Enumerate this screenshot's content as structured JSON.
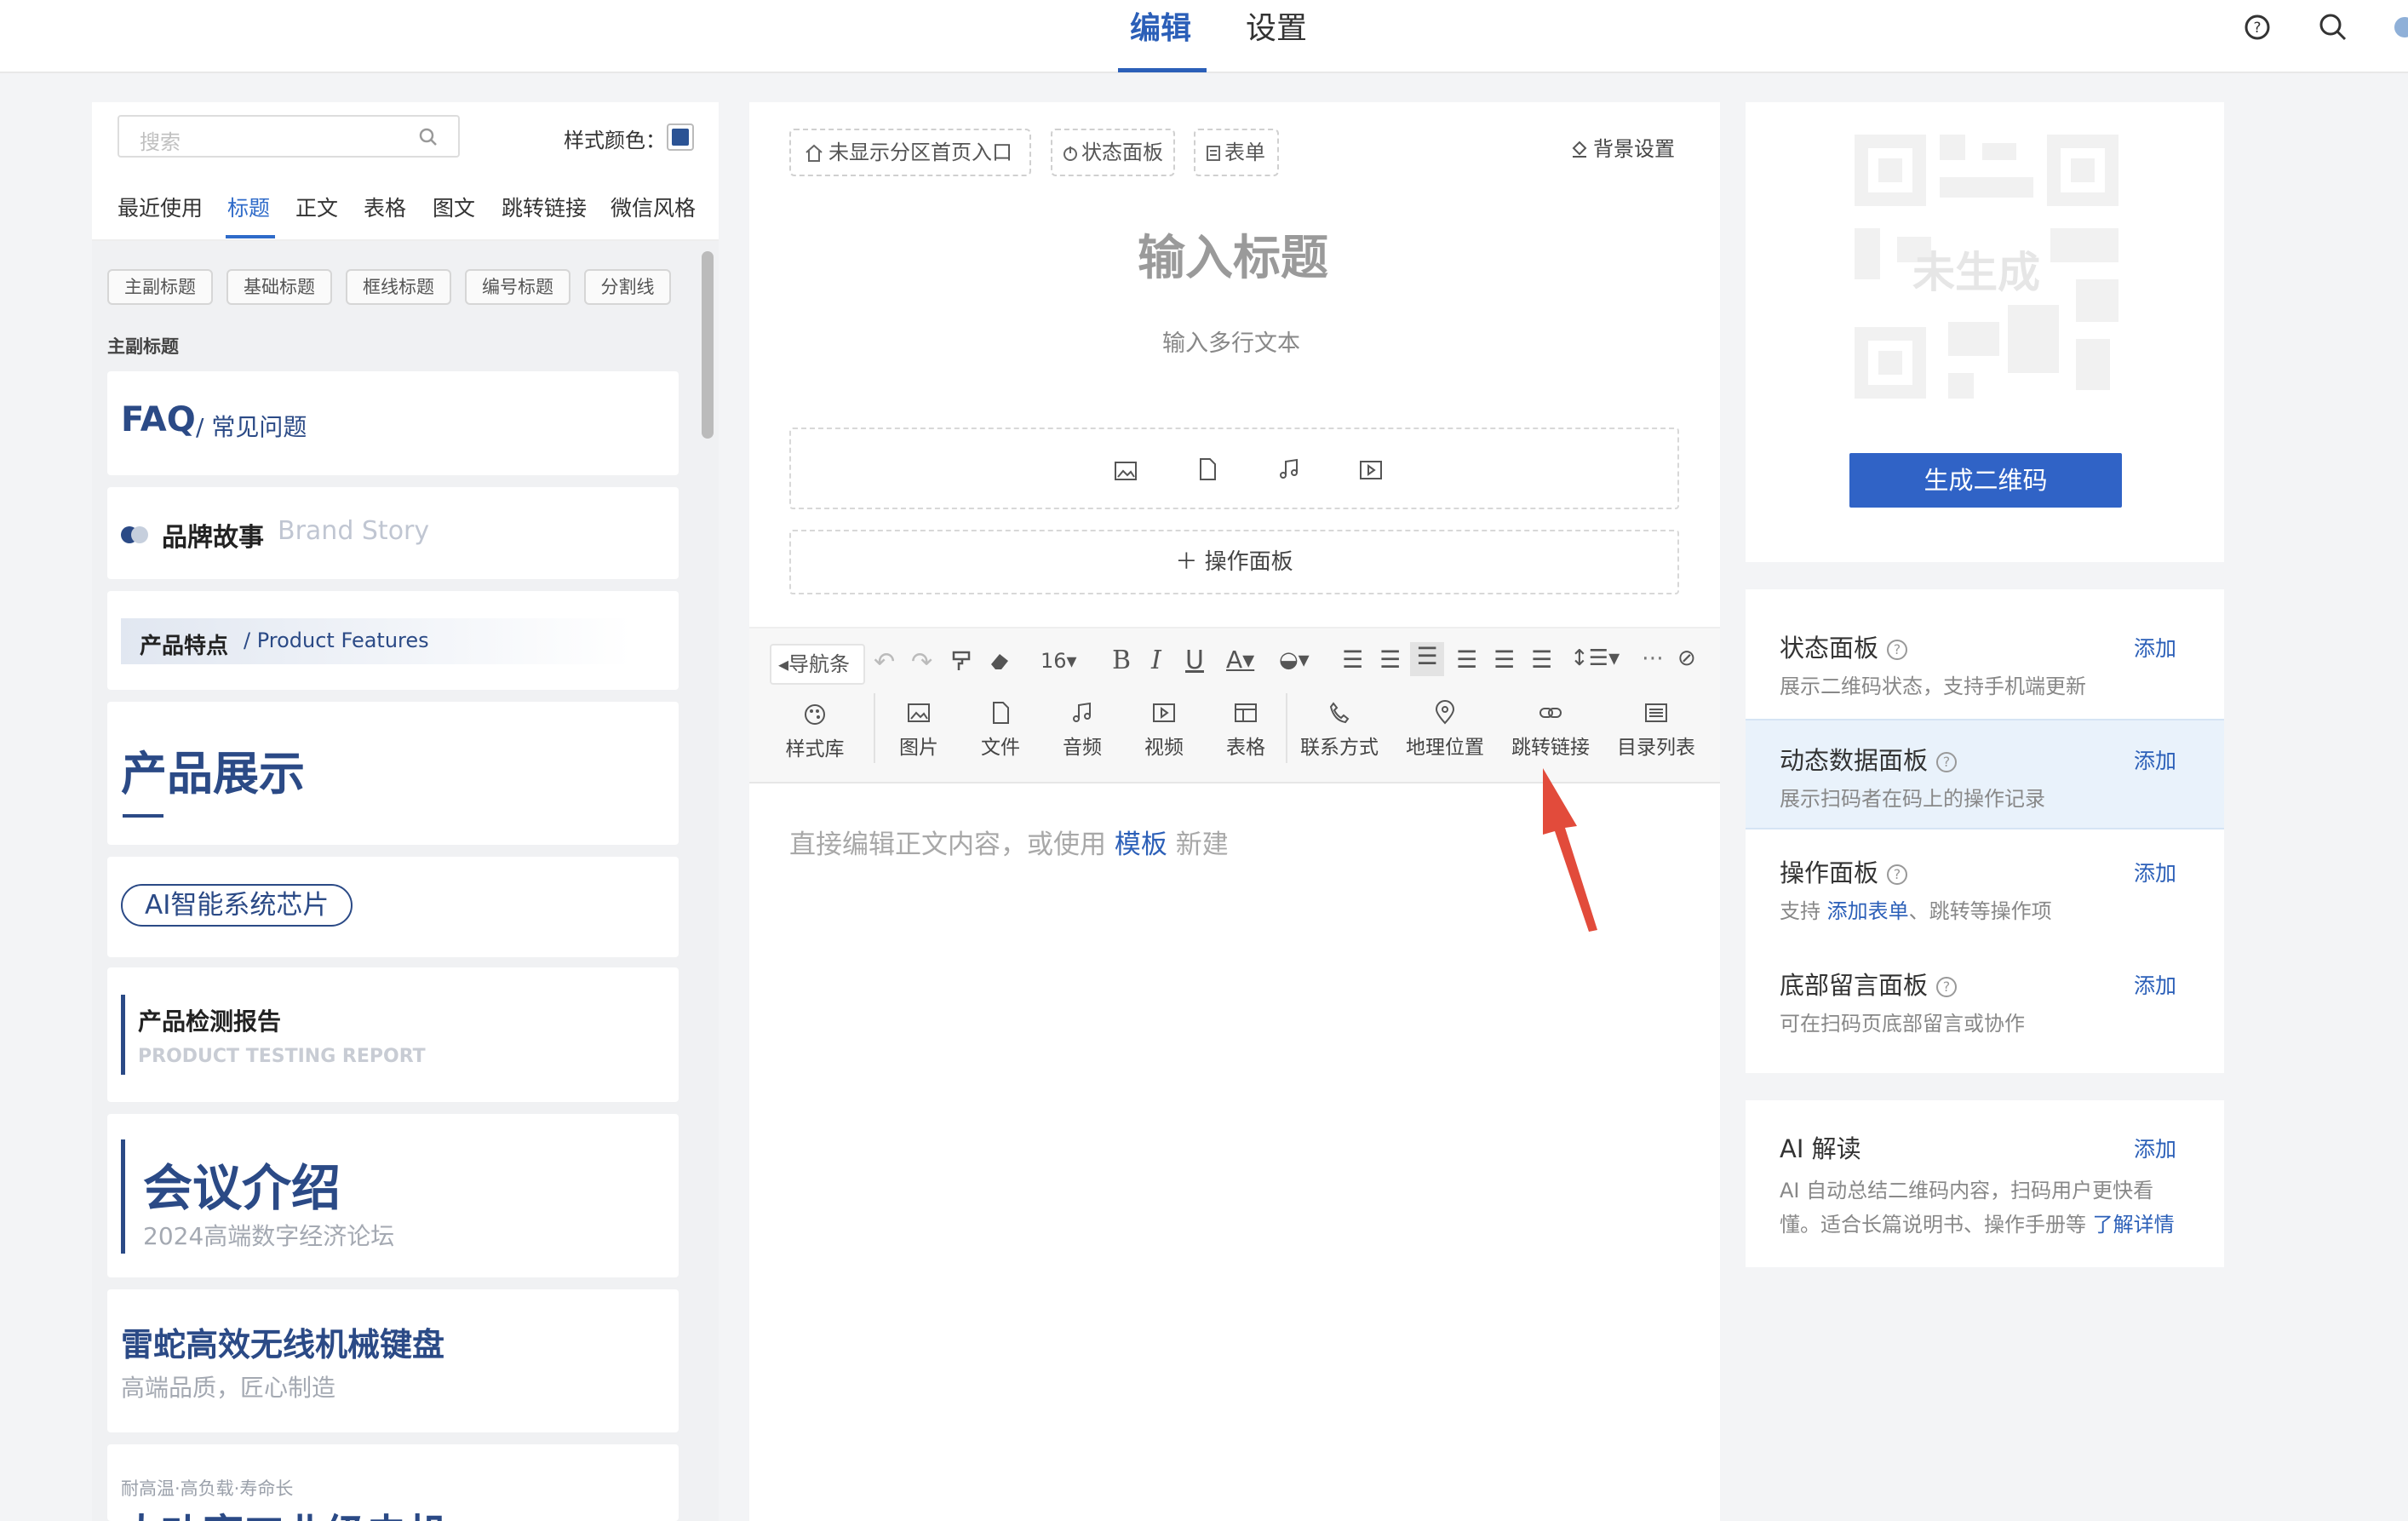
{
  "top_tabs": {
    "edit": "编辑",
    "settings": "设置"
  },
  "left": {
    "search_placeholder": "搜索",
    "style_color_label": "样式颜色：",
    "style_color": "#2b5394",
    "categories": [
      "最近使用",
      "标题",
      "正文",
      "表格",
      "图文",
      "跳转链接",
      "微信风格"
    ],
    "chips": [
      "主副标题",
      "基础标题",
      "框线标题",
      "编号标题",
      "分割线"
    ],
    "section_label": "主副标题",
    "templates": {
      "faq_main": "FAQ",
      "faq_sub": "/ 常见问题",
      "brand_main": "品牌故事",
      "brand_sub": "Brand Story",
      "features_main": "产品特点",
      "features_sub": "/ Product Features",
      "showcase": "产品展示",
      "ai_chip": "AI智能系统芯片",
      "report_main": "产品检测报告",
      "report_sub": "PRODUCT TESTING REPORT",
      "meeting_main": "会议介绍",
      "meeting_sub": "2024高端数字经济论坛",
      "keyboard_main": "雷蛇高效无线机械键盘",
      "keyboard_sub": "高端品质，匠心制造",
      "motor_sub": "耐高温·高负载·寿命长",
      "motor_main": "大功率工业级电机"
    }
  },
  "middle": {
    "top_buttons": [
      "未显示分区首页入口",
      "状态面板",
      "表单"
    ],
    "bg_settings": "背景设置",
    "title_placeholder": "输入标题",
    "multiline_placeholder": "输入多行文本",
    "op_panel": "＋ 操作面板",
    "toolbar": {
      "nav": "导航条",
      "font_size": "16",
      "style_lib": "样式库",
      "buttons": [
        "图片",
        "文件",
        "音频",
        "视频",
        "表格",
        "联系方式",
        "地理位置",
        "跳转链接",
        "目录列表"
      ]
    },
    "body_hint_pre": "直接编辑正文内容，或使用",
    "body_hint_link": "模板",
    "body_hint_post": "新建"
  },
  "right": {
    "qr_status": "未生成",
    "qr_button": "生成二维码",
    "features": [
      {
        "title": "状态面板",
        "add": "添加",
        "desc": "展示二维码状态，支持手机端更新"
      },
      {
        "title": "动态数据面板",
        "add": "添加",
        "desc": "展示扫码者在码上的操作记录"
      },
      {
        "title": "操作面板",
        "add": "添加",
        "desc_pre": "支持",
        "desc_link": "添加表单",
        "desc_post": "、跳转等操作项"
      },
      {
        "title": "底部留言面板",
        "add": "添加",
        "desc": "可在扫码页底部留言或协作"
      }
    ],
    "ai": {
      "title": "AI 解读",
      "add": "添加",
      "desc_line1": "AI 自动总结二维码内容，扫码用户更快看",
      "desc_line2": "懂。适合长篇说明书、操作手册等",
      "link": "了解详情"
    }
  }
}
